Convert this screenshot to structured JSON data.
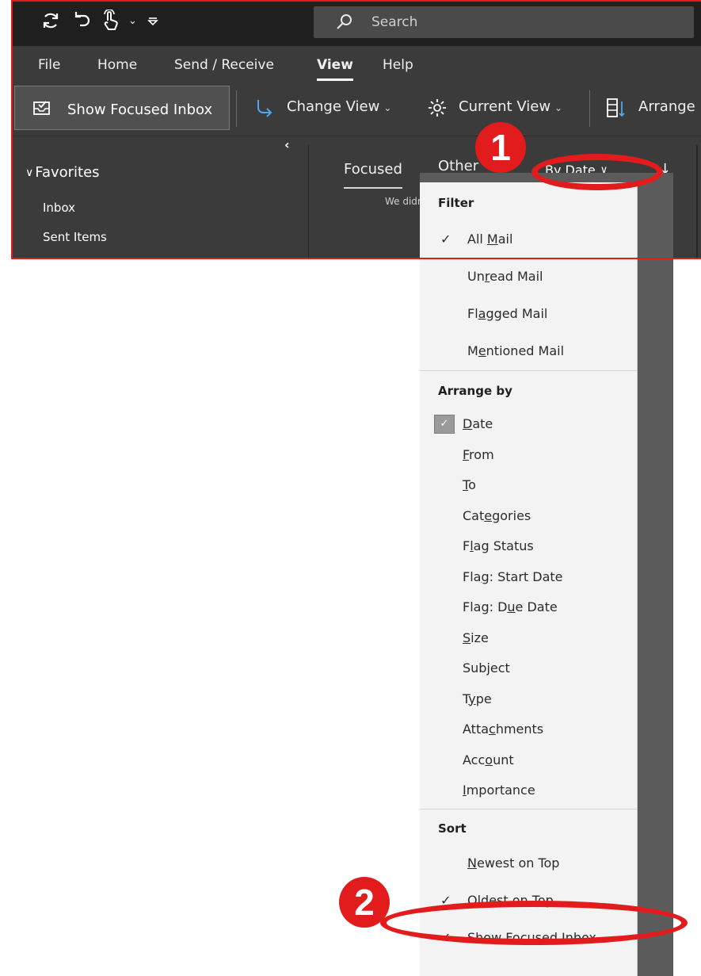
{
  "title_bar": {
    "search_placeholder": "Search",
    "icons": [
      "sync-icon",
      "undo-icon",
      "touch-mode-icon",
      "chevron-down-icon",
      "customize-qat-icon"
    ]
  },
  "menu_tabs": [
    "File",
    "Home",
    "Send / Receive",
    "View",
    "Help"
  ],
  "active_tab": "View",
  "ribbon": {
    "show_focused_inbox": "Show Focused Inbox",
    "change_view": "Change View",
    "current_view": "Current View",
    "arrange": "Arrange"
  },
  "navigation": {
    "favorites": "Favorites",
    "inbox": "Inbox",
    "sent_items": "Sent Items"
  },
  "mail_list": {
    "focused_tab": "Focused",
    "other_tab": "Other",
    "arrange_by": "By Date",
    "notice": "We didn"
  },
  "dropdown": {
    "filter_header": "Filter",
    "filter_items": [
      {
        "pre": "All ",
        "key": "M",
        "post": "ail",
        "checked": true
      },
      {
        "pre": "Un",
        "key": "r",
        "post": "ead Mail",
        "checked": false
      },
      {
        "pre": "Fl",
        "key": "a",
        "post": "gged Mail",
        "checked": false
      },
      {
        "pre": "M",
        "key": "e",
        "post": "ntioned Mail",
        "checked": false
      }
    ],
    "arrange_header": "Arrange by",
    "arrange_items": [
      {
        "pre": "",
        "key": "D",
        "post": "ate",
        "checked": true
      },
      {
        "pre": "",
        "key": "F",
        "post": "rom",
        "checked": false
      },
      {
        "pre": "",
        "key": "T",
        "post": "o",
        "checked": false
      },
      {
        "pre": "Cat",
        "key": "e",
        "post": "gories",
        "checked": false
      },
      {
        "pre": "F",
        "key": "l",
        "post": "ag Status",
        "checked": false
      },
      {
        "pre": "Fla",
        "key": "g",
        "post": ": Start Date",
        "checked": false
      },
      {
        "pre": "Flag: D",
        "key": "u",
        "post": "e Date",
        "checked": false
      },
      {
        "pre": "",
        "key": "S",
        "post": "ize",
        "checked": false
      },
      {
        "pre": "Sub",
        "key": "j",
        "post": "ect",
        "checked": false
      },
      {
        "pre": "T",
        "key": "y",
        "post": "pe",
        "checked": false
      },
      {
        "pre": "Atta",
        "key": "c",
        "post": "hments",
        "checked": false
      },
      {
        "pre": "Acc",
        "key": "o",
        "post": "unt",
        "checked": false
      },
      {
        "pre": "",
        "key": "I",
        "post": "mportance",
        "checked": false
      }
    ],
    "sort_header": "Sort",
    "sort_items": [
      {
        "pre": "",
        "key": "N",
        "post": "ewest on Top",
        "checked": false
      },
      {
        "pre": "O",
        "key": "l",
        "post": "dest on Top",
        "checked": true
      },
      {
        "pre": "Sho",
        "key": "w",
        "post": " Focused Inbox",
        "checked": true
      }
    ]
  },
  "annotations": {
    "badge_1": "1",
    "badge_2": "2",
    "color": "#e21c1c"
  },
  "colors": {
    "window_bg": "#3b3b3b",
    "title_bar_bg": "#1f1f1f",
    "menu_bg": "#f3f3f3"
  }
}
